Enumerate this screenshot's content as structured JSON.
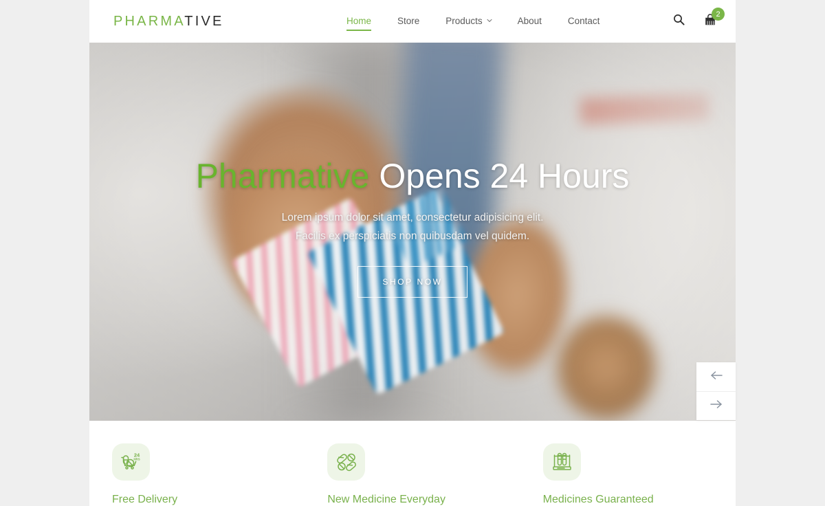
{
  "theme": {
    "accent_green": "#7ab648",
    "hero_accent_green": "#69b42e",
    "page_bg": "#efefef",
    "container_bg": "#ffffff",
    "nav_text": "#5a5a5a",
    "feature_icon_bg": "#eef5e7"
  },
  "header": {
    "logo": {
      "green_part": "PHARMA",
      "dark_part": "TIVE"
    },
    "nav": [
      {
        "label": "Home",
        "active": true,
        "has_dropdown": false
      },
      {
        "label": "Store",
        "active": false,
        "has_dropdown": false
      },
      {
        "label": "Products",
        "active": false,
        "has_dropdown": true
      },
      {
        "label": "About",
        "active": false,
        "has_dropdown": false
      },
      {
        "label": "Contact",
        "active": false,
        "has_dropdown": false
      }
    ],
    "actions": {
      "search_icon": "search-icon",
      "cart_icon": "shopping-bag-icon",
      "cart_count": "2"
    }
  },
  "hero": {
    "title_accent": "Pharmative",
    "title_rest": " Opens 24 Hours",
    "subtitle_line1": "Lorem ipsum dolor sit amet, consectetur adipisicing elit.",
    "subtitle_line2": "Facilis ex perspiciatis non quibusdam vel quidem.",
    "cta_label": "SHOP NOW",
    "image_description": "Blurred photo of a pharmacist in a white coat holding pink and blue pill blister packs, with a thumbs-up hand",
    "slider": {
      "prev_icon": "arrow-left-icon",
      "prev_glyph": "←",
      "next_icon": "arrow-right-icon",
      "next_glyph": "→"
    }
  },
  "features": [
    {
      "label": "Free Delivery",
      "icon": "delivery-cart-24hrs-icon",
      "icon_badge": "24",
      "icon_badge_sub": "HRS"
    },
    {
      "label": "New Medicine Everyday",
      "icon": "pills-capsules-icon"
    },
    {
      "label": "Medicines Guaranteed",
      "icon": "test-tube-rack-icon"
    }
  ]
}
